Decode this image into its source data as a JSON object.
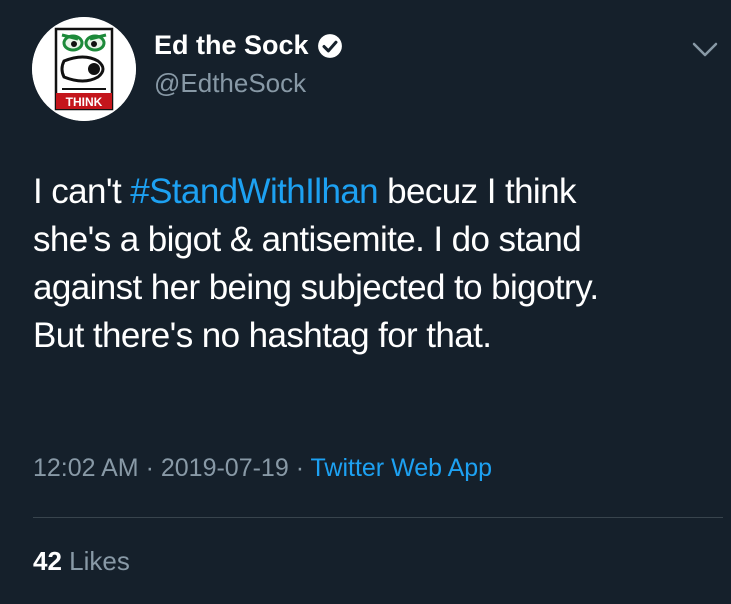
{
  "user": {
    "display_name": "Ed the Sock",
    "handle": "@EdtheSock",
    "avatar_label": "THINK",
    "verified_icon": "verified-badge-icon"
  },
  "tweet": {
    "lines": [
      {
        "before": "I can't ",
        "hashtag": "#StandWithIlhan",
        "after": " becuz I think"
      },
      {
        "text": "she's a bigot & antisemite. I do stand"
      },
      {
        "text": "against her being subjected to bigotry."
      },
      {
        "text": "But there's no hashtag for that."
      }
    ]
  },
  "meta": {
    "time": "12:02 AM",
    "separator": " · ",
    "date": "2019-07-19",
    "source": "Twitter Web App"
  },
  "stats": {
    "likes_count": "42",
    "likes_label": " Likes"
  },
  "colors": {
    "background": "#15202b",
    "accent": "#1da1f2",
    "secondary_text": "#8899a6",
    "divider": "#38444d"
  }
}
